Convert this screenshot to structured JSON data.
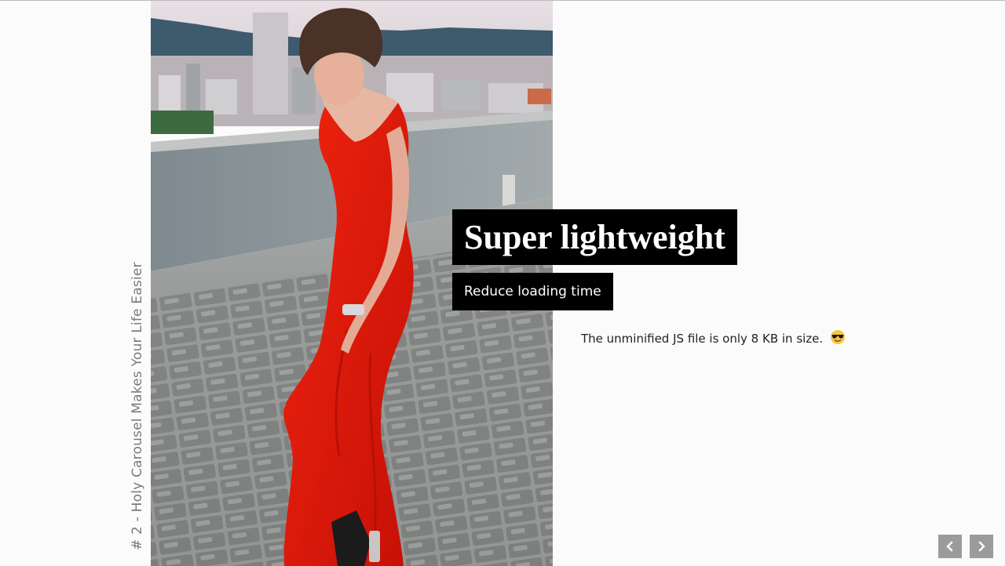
{
  "slide": {
    "label": "# 2 - Holy Carousel Makes Your Life Easier",
    "title": "Super lightweight",
    "subtitle": "Reduce loading time",
    "description": "The unminified JS file is only 8 KB in size.",
    "emoji": "smiling-face-with-sunglasses"
  },
  "navigation": {
    "prev_icon": "chevron-left-icon",
    "next_icon": "chevron-right-icon"
  },
  "colors": {
    "background": "#fbfbfb",
    "caption_box": "#000000",
    "caption_text": "#ffffff",
    "nav_button": "#9b9b9b",
    "dress": "#e3150b"
  }
}
